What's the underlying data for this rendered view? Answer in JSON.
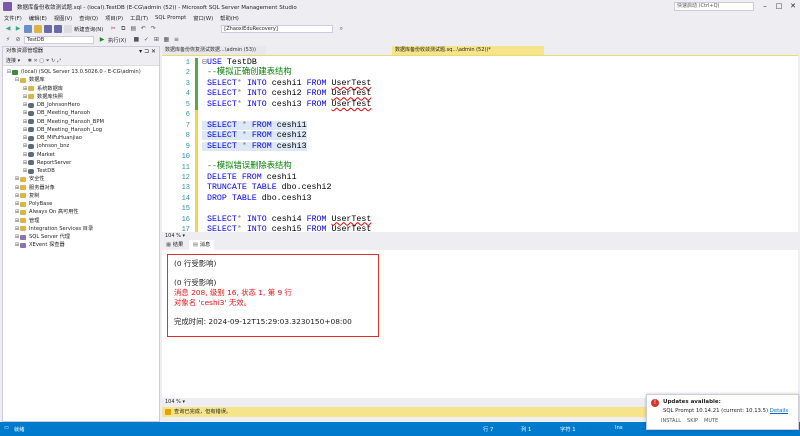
{
  "window": {
    "title": "数据库备份收敛测试题.sql - (local).TestDB (E-CG\\admin (52)) - Microsoft SQL Server Management Studio",
    "quick_launch_placeholder": "快速启动 (Ctrl+Q)"
  },
  "menu": [
    "文件(F)",
    "编辑(E)",
    "视图(V)",
    "查询(Q)",
    "项目(P)",
    "工具(T)",
    "SQL Prompt",
    "窗口(W)",
    "帮助(H)"
  ],
  "toolbar": {
    "new_query": "新建查询(N)",
    "db_combo": "[ZhaoxiEduRecovery]",
    "current_db": "TestDB",
    "execute": "执行(X)"
  },
  "object_explorer": {
    "title": "对象资源管理器",
    "connect": "连接 ▾",
    "nodes": [
      {
        "label": "(local) (SQL Server 13.0.5026.0 - E-CG\\admin)",
        "indent": 0,
        "toggle": "⊟",
        "icon": "server"
      },
      {
        "label": "数据库",
        "indent": 1,
        "toggle": "⊟",
        "icon": "folder"
      },
      {
        "label": "系统数据库",
        "indent": 2,
        "toggle": "⊞",
        "icon": "folder"
      },
      {
        "label": "数据库快照",
        "indent": 2,
        "toggle": "⊞",
        "icon": "folder"
      },
      {
        "label": "DB_JohnsonHero",
        "indent": 2,
        "toggle": "⊞",
        "icon": "db"
      },
      {
        "label": "DB_Meeting_Hansoh",
        "indent": 2,
        "toggle": "⊞",
        "icon": "db"
      },
      {
        "label": "DB_Meeting_Hansoh_BPM",
        "indent": 2,
        "toggle": "⊞",
        "icon": "db"
      },
      {
        "label": "DB_Meeting_Hansoh_Log",
        "indent": 2,
        "toggle": "⊞",
        "icon": "db"
      },
      {
        "label": "DB_MiFuHuanjiao",
        "indent": 2,
        "toggle": "⊞",
        "icon": "db"
      },
      {
        "label": "johnson_bnz",
        "indent": 2,
        "toggle": "⊞",
        "icon": "db"
      },
      {
        "label": "Market",
        "indent": 2,
        "toggle": "⊞",
        "icon": "db"
      },
      {
        "label": "ReportServer",
        "indent": 2,
        "toggle": "⊞",
        "icon": "db"
      },
      {
        "label": "TestDB",
        "indent": 2,
        "toggle": "⊞",
        "icon": "db"
      },
      {
        "label": "安全性",
        "indent": 1,
        "toggle": "⊞",
        "icon": "folder"
      },
      {
        "label": "服务器对象",
        "indent": 1,
        "toggle": "⊞",
        "icon": "folder"
      },
      {
        "label": "复制",
        "indent": 1,
        "toggle": "⊞",
        "icon": "folder"
      },
      {
        "label": "PolyBase",
        "indent": 1,
        "toggle": "⊞",
        "icon": "folder"
      },
      {
        "label": "Always On 高可用性",
        "indent": 1,
        "toggle": "⊞",
        "icon": "folder"
      },
      {
        "label": "管理",
        "indent": 1,
        "toggle": "⊞",
        "icon": "folder"
      },
      {
        "label": "Integration Services 目录",
        "indent": 1,
        "toggle": "⊞",
        "icon": "folder"
      },
      {
        "label": "SQL Server 代理",
        "indent": 1,
        "toggle": "⊞",
        "icon": "misc"
      },
      {
        "label": "XEvent 探查器",
        "indent": 1,
        "toggle": "⊞",
        "icon": "misc"
      }
    ]
  },
  "editor_tabs": {
    "inactive": "数据库备份恢复测试数据...\\admin (53))",
    "active": "数据库备份收敛测试题.sq...\\admin (52))*"
  },
  "code": {
    "line_numbers": [
      "1",
      "2",
      "3",
      "4",
      "5",
      "6",
      "7",
      "8",
      "9",
      "10",
      "11",
      "12",
      "13",
      "14",
      "15",
      "16",
      "17"
    ],
    "lines": [
      [
        {
          "t": "⊟",
          "c": "gray"
        },
        {
          "t": "USE ",
          "c": "kw"
        },
        {
          "t": "TestDB",
          "c": "id"
        }
      ],
      [
        {
          "t": " --模拟正确创建表结构",
          "c": "cm"
        }
      ],
      [
        {
          "t": " SELECT",
          "c": "kw"
        },
        {
          "t": "* ",
          "c": "gray"
        },
        {
          "t": "INTO ",
          "c": "kw"
        },
        {
          "t": "ceshi1 ",
          "c": "id"
        },
        {
          "t": "FROM ",
          "c": "kw"
        },
        {
          "t": "UserTest",
          "c": "id",
          "u": true
        }
      ],
      [
        {
          "t": " SELECT",
          "c": "kw"
        },
        {
          "t": "* ",
          "c": "gray"
        },
        {
          "t": "INTO ",
          "c": "kw"
        },
        {
          "t": "ceshi2 ",
          "c": "id"
        },
        {
          "t": "FROM ",
          "c": "kw"
        },
        {
          "t": "UserTest",
          "c": "id",
          "u": true
        }
      ],
      [
        {
          "t": " SELECT",
          "c": "kw"
        },
        {
          "t": "* ",
          "c": "gray"
        },
        {
          "t": "INTO ",
          "c": "kw"
        },
        {
          "t": "ceshi3 ",
          "c": "id"
        },
        {
          "t": "FROM ",
          "c": "kw"
        },
        {
          "t": "UserTest",
          "c": "id",
          "u": true
        }
      ],
      [
        {
          "t": " ",
          "c": "id"
        }
      ],
      [
        {
          "t": " SELECT ",
          "c": "kw"
        },
        {
          "t": "* ",
          "c": "gray"
        },
        {
          "t": "FROM ",
          "c": "kw"
        },
        {
          "t": "ceshi1",
          "c": "id"
        }
      ],
      [
        {
          "t": " SELECT ",
          "c": "kw"
        },
        {
          "t": "* ",
          "c": "gray"
        },
        {
          "t": "FROM ",
          "c": "kw"
        },
        {
          "t": "ceshi2",
          "c": "id"
        }
      ],
      [
        {
          "t": " SELECT ",
          "c": "kw"
        },
        {
          "t": "* ",
          "c": "gray"
        },
        {
          "t": "FROM ",
          "c": "kw"
        },
        {
          "t": "ceshi3",
          "c": "id"
        }
      ],
      [
        {
          "t": " ",
          "c": "id"
        }
      ],
      [
        {
          "t": " --模拟错误删除表结构",
          "c": "cm"
        }
      ],
      [
        {
          "t": " DELETE FROM ",
          "c": "kw"
        },
        {
          "t": "ceshi1",
          "c": "id"
        }
      ],
      [
        {
          "t": " TRUNCATE TABLE ",
          "c": "kw"
        },
        {
          "t": "dbo.ceshi2",
          "c": "id"
        }
      ],
      [
        {
          "t": " DROP TABLE ",
          "c": "kw"
        },
        {
          "t": "dbo.ceshi3",
          "c": "id"
        }
      ],
      [
        {
          "t": " ",
          "c": "id"
        }
      ],
      [
        {
          "t": " SELECT",
          "c": "kw"
        },
        {
          "t": "* ",
          "c": "gray"
        },
        {
          "t": "INTO ",
          "c": "kw"
        },
        {
          "t": "ceshi4 ",
          "c": "id"
        },
        {
          "t": "FROM ",
          "c": "kw"
        },
        {
          "t": "UserTest",
          "c": "id",
          "u": true
        }
      ],
      [
        {
          "t": " SELECT",
          "c": "kw"
        },
        {
          "t": "* ",
          "c": "gray"
        },
        {
          "t": "INTO ",
          "c": "kw"
        },
        {
          "t": "ceshi5 ",
          "c": "id"
        },
        {
          "t": "FROM ",
          "c": "kw"
        },
        {
          "t": "UserTest",
          "c": "id",
          "u": true
        }
      ]
    ],
    "highlight_lines": [
      7,
      8,
      9
    ]
  },
  "zoom_editor": "104 % ▾",
  "results": {
    "tab_results": "结果",
    "tab_messages": "消息",
    "messages": [
      {
        "text": "(0 行受影响)",
        "red": false
      },
      {
        "text": "(0 行受影响)",
        "red": false
      },
      {
        "text": "消息 208, 级别 16, 状态 1, 第 9 行",
        "red": true
      },
      {
        "text": "对象名 'ceshi3' 无效。",
        "red": true
      },
      {
        "text": "完成时间: 2024-09-12T15:29:03.3230150+08:00",
        "red": false
      }
    ]
  },
  "zoom_results": "104 % ▾",
  "query_status": "查询已完成，但有错误。",
  "statusbar": {
    "ready": "就绪",
    "row": "行 7",
    "col": "列 1",
    "char": "字符 1",
    "ins": "Ins"
  },
  "notification": {
    "title": "Updates available:",
    "body": "SQL Prompt 10.14.21 (current: 10.13.5)",
    "details": "Details",
    "actions": [
      "INSTALL",
      "SKIP",
      "MUTE"
    ]
  },
  "colors": {
    "accent": "#007acc",
    "tab_active": "#f6e48a",
    "error": "#e11"
  }
}
